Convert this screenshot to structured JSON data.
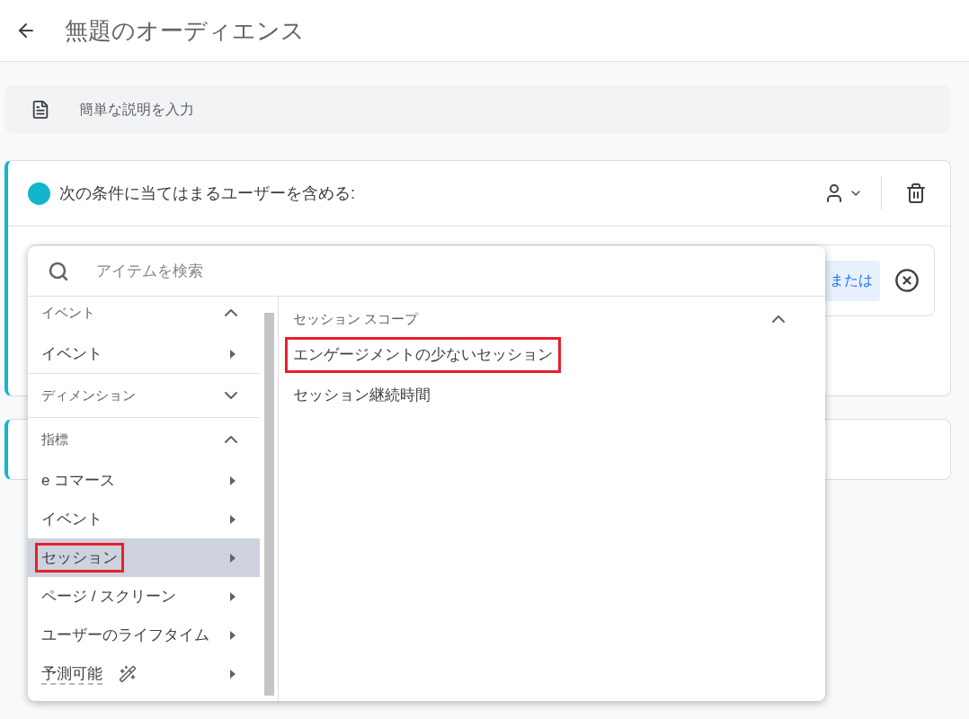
{
  "header": {
    "title": "無題のオーディエンス"
  },
  "description": {
    "placeholder": "簡単な説明を入力"
  },
  "condition_group": {
    "title": "次の条件に当てはまるユーザーを含める:",
    "color": "#12b5cb",
    "or_button": "または"
  },
  "picker": {
    "search": {
      "placeholder": "アイテムを検索"
    },
    "sections": [
      {
        "label": "イベント",
        "expanded": true,
        "items": [
          {
            "label": "イベント",
            "selected": false,
            "highlighted": false,
            "kind": "plain"
          }
        ]
      },
      {
        "label": "ディメンション",
        "expanded": false
      },
      {
        "label": "指標",
        "expanded": true,
        "items": [
          {
            "label": "e コマース",
            "selected": false,
            "highlighted": false,
            "kind": "plain"
          },
          {
            "label": "イベント",
            "selected": false,
            "highlighted": false,
            "kind": "plain"
          },
          {
            "label": "セッション",
            "selected": true,
            "highlighted": true,
            "kind": "plain"
          },
          {
            "label": "ページ / スクリーン",
            "selected": false,
            "highlighted": false,
            "kind": "plain"
          },
          {
            "label": "ユーザーのライフタイム",
            "selected": false,
            "highlighted": false,
            "kind": "plain"
          },
          {
            "label": "予測可能",
            "selected": false,
            "highlighted": false,
            "kind": "predictive"
          }
        ]
      }
    ],
    "detail": {
      "label": "セッション スコープ",
      "expanded": true,
      "items": [
        {
          "label": "エンゲージメントの少ないセッション",
          "highlighted": true
        },
        {
          "label": "セッション継続時間",
          "highlighted": false
        }
      ]
    }
  }
}
